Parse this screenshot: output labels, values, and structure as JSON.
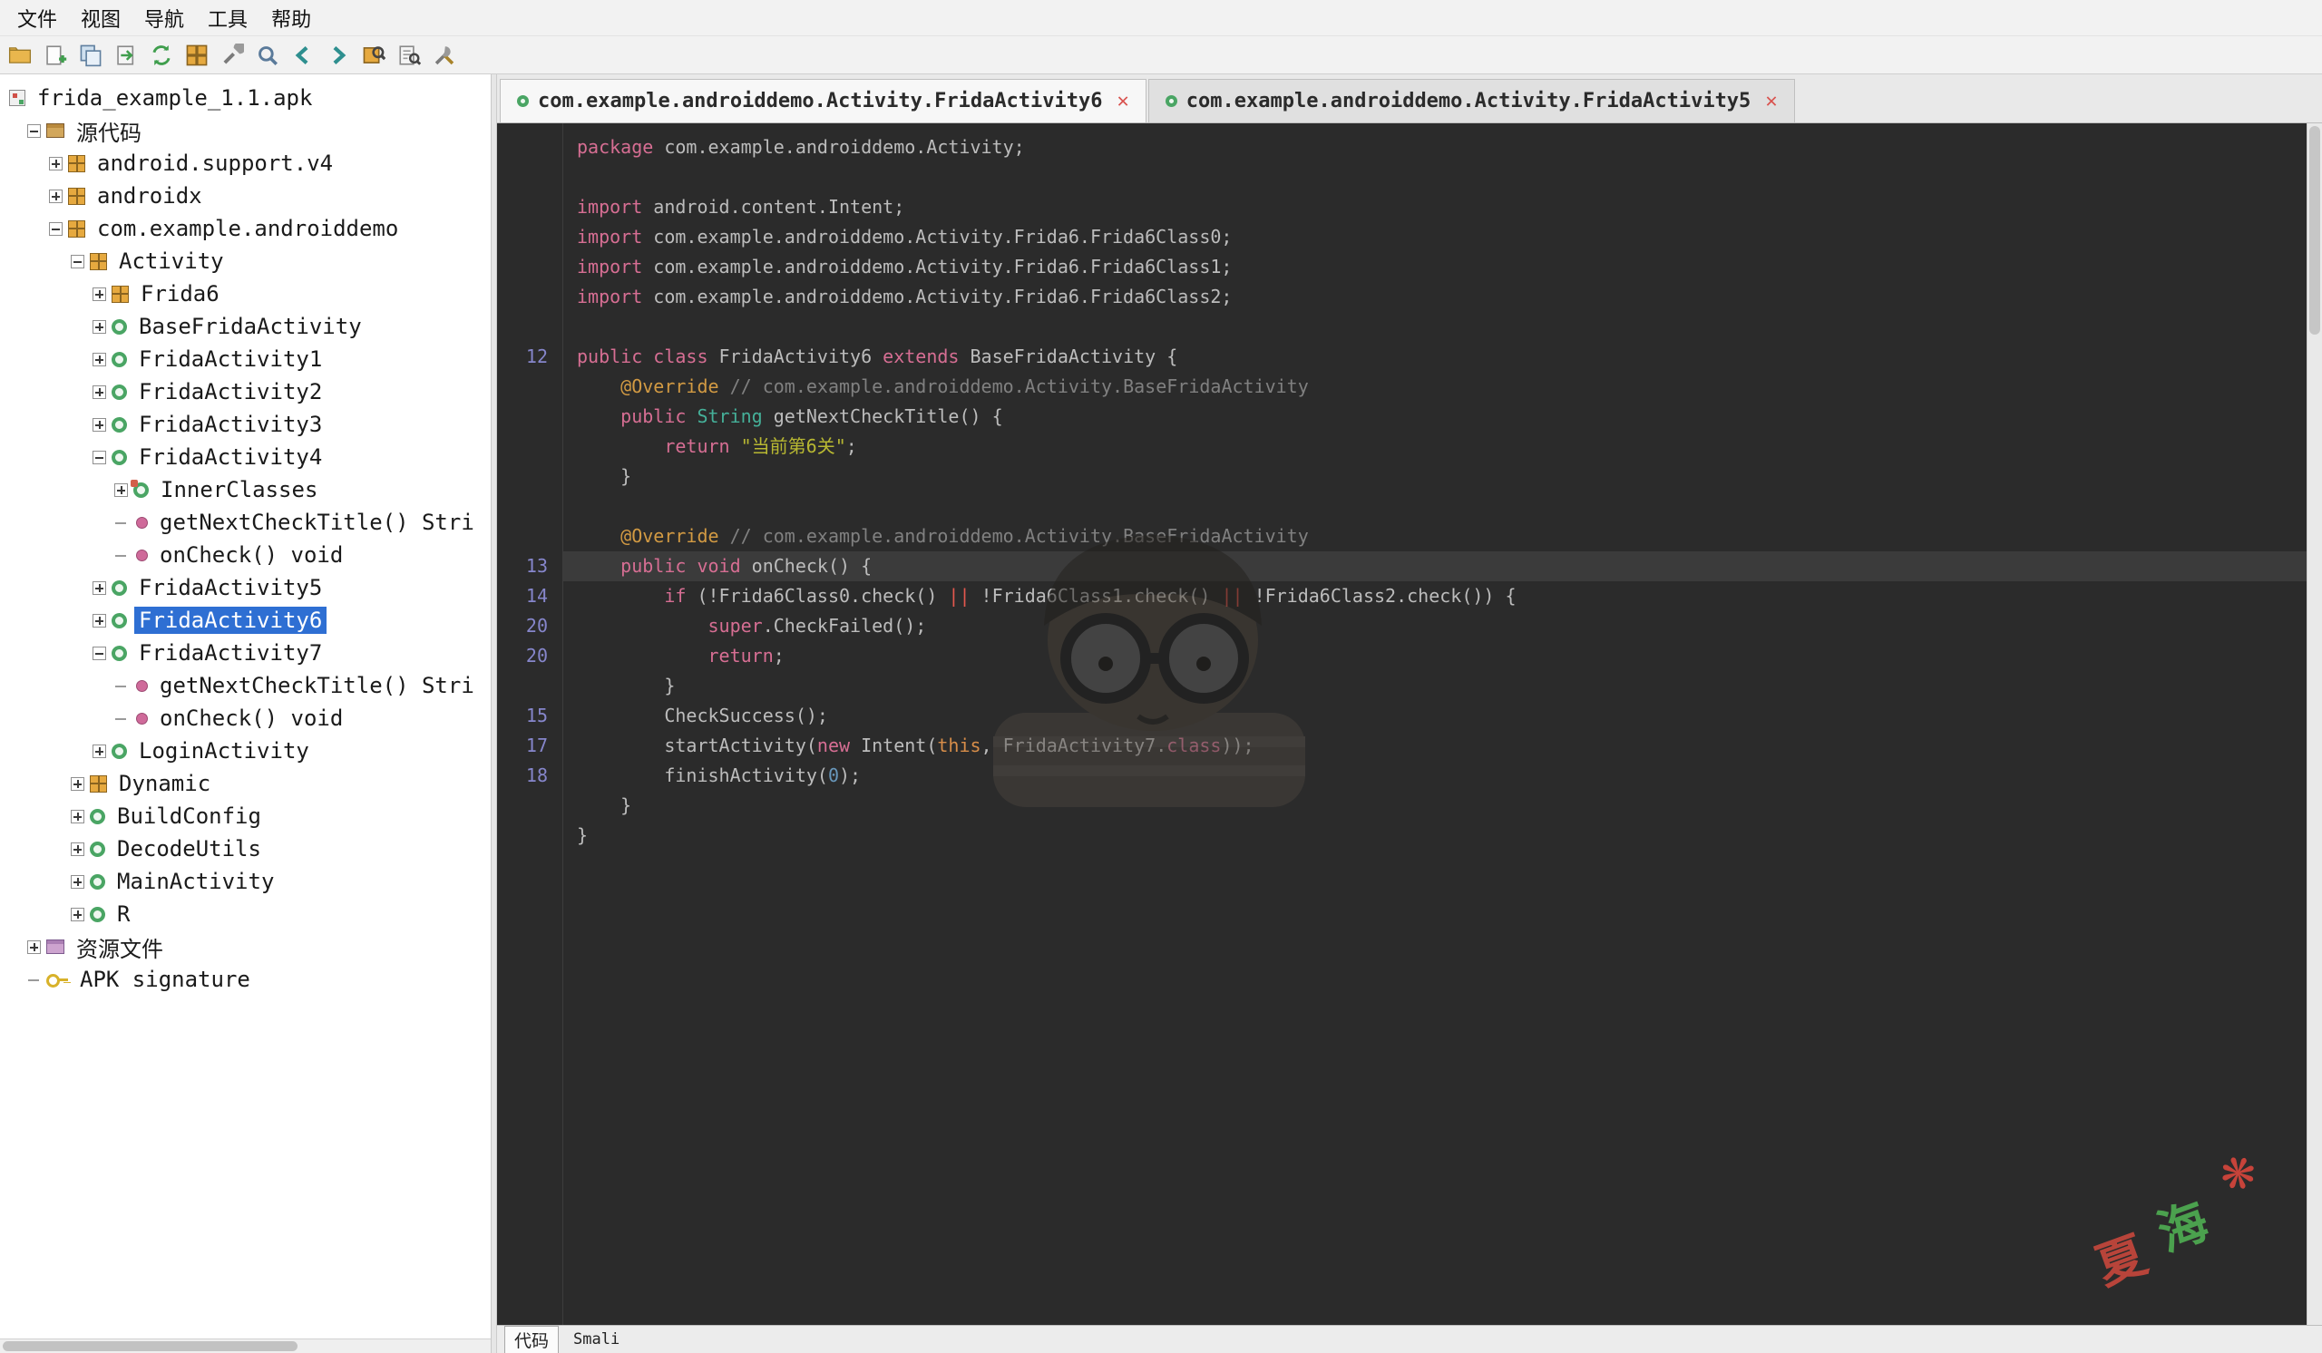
{
  "menu": {
    "items": [
      "文件",
      "视图",
      "导航",
      "工具",
      "帮助"
    ]
  },
  "toolbar": {
    "icons": [
      "open-file",
      "add-files",
      "save-all",
      "export",
      "sync",
      "flat-packages",
      "deobfuscation",
      "search",
      "back",
      "forward",
      "class-search",
      "text-search",
      "preferences"
    ]
  },
  "tree": {
    "items": [
      {
        "label": "frida_example_1.1.apk",
        "level": 0,
        "toggle": "none",
        "icon": "apk",
        "selected": false
      },
      {
        "label": "源代码",
        "level": 1,
        "toggle": "minus",
        "icon": "source",
        "selected": false
      },
      {
        "label": "android.support.v4",
        "level": 2,
        "toggle": "plus",
        "icon": "package",
        "selected": false
      },
      {
        "label": "androidx",
        "level": 2,
        "toggle": "plus",
        "icon": "package",
        "selected": false
      },
      {
        "label": "com.example.androiddemo",
        "level": 2,
        "toggle": "minus",
        "icon": "package",
        "selected": false
      },
      {
        "label": "Activity",
        "level": 3,
        "toggle": "minus",
        "icon": "package",
        "selected": false
      },
      {
        "label": "Frida6",
        "level": 4,
        "toggle": "plus",
        "icon": "package",
        "selected": false
      },
      {
        "label": "BaseFridaActivity",
        "level": 4,
        "toggle": "plus",
        "icon": "class",
        "selected": false
      },
      {
        "label": "FridaActivity1",
        "level": 4,
        "toggle": "plus",
        "icon": "class",
        "selected": false
      },
      {
        "label": "FridaActivity2",
        "level": 4,
        "toggle": "plus",
        "icon": "class",
        "selected": false
      },
      {
        "label": "FridaActivity3",
        "level": 4,
        "toggle": "plus",
        "icon": "class",
        "selected": false
      },
      {
        "label": "FridaActivity4",
        "level": 4,
        "toggle": "minus",
        "icon": "class",
        "selected": false
      },
      {
        "label": "InnerClasses",
        "level": 5,
        "toggle": "plus",
        "icon": "innerclass",
        "selected": false
      },
      {
        "label": "getNextCheckTitle() Stri",
        "level": 5,
        "toggle": "dash",
        "icon": "method",
        "selected": false
      },
      {
        "label": "onCheck() void",
        "level": 5,
        "toggle": "dash",
        "icon": "method",
        "selected": false
      },
      {
        "label": "FridaActivity5",
        "level": 4,
        "toggle": "plus",
        "icon": "class",
        "selected": false
      },
      {
        "label": "FridaActivity6",
        "level": 4,
        "toggle": "plus",
        "icon": "class",
        "selected": true
      },
      {
        "label": "FridaActivity7",
        "level": 4,
        "toggle": "minus",
        "icon": "class",
        "selected": false
      },
      {
        "label": "getNextCheckTitle() Stri",
        "level": 5,
        "toggle": "dash",
        "icon": "method",
        "selected": false
      },
      {
        "label": "onCheck() void",
        "level": 5,
        "toggle": "dash",
        "icon": "method",
        "selected": false
      },
      {
        "label": "LoginActivity",
        "level": 4,
        "toggle": "plus",
        "icon": "class",
        "selected": false
      },
      {
        "label": "Dynamic",
        "level": 3,
        "toggle": "plus",
        "icon": "package",
        "selected": false
      },
      {
        "label": "BuildConfig",
        "level": 3,
        "toggle": "plus",
        "icon": "class",
        "selected": false
      },
      {
        "label": "DecodeUtils",
        "level": 3,
        "toggle": "plus",
        "icon": "class",
        "selected": false
      },
      {
        "label": "MainActivity",
        "level": 3,
        "toggle": "plus",
        "icon": "class",
        "selected": false
      },
      {
        "label": "R",
        "level": 3,
        "toggle": "plus",
        "icon": "class",
        "selected": false
      },
      {
        "label": "资源文件",
        "level": 1,
        "toggle": "plus",
        "icon": "resource",
        "selected": false
      },
      {
        "label": "APK signature",
        "level": 1,
        "toggle": "dash",
        "icon": "key",
        "selected": false
      }
    ]
  },
  "tabs": [
    {
      "label": "com.example.androiddemo.Activity.FridaActivity6",
      "active": true
    },
    {
      "label": "com.example.androiddemo.Activity.FridaActivity5",
      "active": false
    }
  ],
  "editor": {
    "lines": [
      {
        "num": "",
        "hl": false,
        "tokens": [
          {
            "t": "package ",
            "c": "kw"
          },
          {
            "t": "com.example.androiddemo.Activity;",
            "c": "def"
          }
        ]
      },
      {
        "num": "",
        "hl": false,
        "tokens": []
      },
      {
        "num": "",
        "hl": false,
        "tokens": [
          {
            "t": "import ",
            "c": "kw"
          },
          {
            "t": "android.content.Intent;",
            "c": "def"
          }
        ]
      },
      {
        "num": "",
        "hl": false,
        "tokens": [
          {
            "t": "import ",
            "c": "kw"
          },
          {
            "t": "com.example.androiddemo.Activity.Frida6.Frida6Class0;",
            "c": "def"
          }
        ]
      },
      {
        "num": "",
        "hl": false,
        "tokens": [
          {
            "t": "import ",
            "c": "kw"
          },
          {
            "t": "com.example.androiddemo.Activity.Frida6.Frida6Class1;",
            "c": "def"
          }
        ]
      },
      {
        "num": "",
        "hl": false,
        "tokens": [
          {
            "t": "import ",
            "c": "kw"
          },
          {
            "t": "com.example.androiddemo.Activity.Frida6.Frida6Class2;",
            "c": "def"
          }
        ]
      },
      {
        "num": "",
        "hl": false,
        "tokens": []
      },
      {
        "num": "12",
        "hl": false,
        "tokens": [
          {
            "t": "public class ",
            "c": "kw"
          },
          {
            "t": "FridaActivity6 ",
            "c": "def"
          },
          {
            "t": "extends ",
            "c": "kw"
          },
          {
            "t": "BaseFridaActivity {",
            "c": "def"
          }
        ]
      },
      {
        "num": "",
        "hl": false,
        "tokens": [
          {
            "t": "    ",
            "c": "def"
          },
          {
            "t": "@Override ",
            "c": "ann"
          },
          {
            "t": "// com.example.androiddemo.Activity.BaseFridaActivity",
            "c": "com"
          }
        ]
      },
      {
        "num": "",
        "hl": false,
        "tokens": [
          {
            "t": "    ",
            "c": "def"
          },
          {
            "t": "public ",
            "c": "kw"
          },
          {
            "t": "String ",
            "c": "type"
          },
          {
            "t": "getNextCheckTitle() {",
            "c": "def"
          }
        ]
      },
      {
        "num": "",
        "hl": false,
        "tokens": [
          {
            "t": "        ",
            "c": "def"
          },
          {
            "t": "return ",
            "c": "kw"
          },
          {
            "t": "\"当前第6关\"",
            "c": "str"
          },
          {
            "t": ";",
            "c": "def"
          }
        ]
      },
      {
        "num": "",
        "hl": false,
        "tokens": [
          {
            "t": "    }",
            "c": "def"
          }
        ]
      },
      {
        "num": "",
        "hl": false,
        "tokens": []
      },
      {
        "num": "",
        "hl": false,
        "tokens": [
          {
            "t": "    ",
            "c": "def"
          },
          {
            "t": "@Override ",
            "c": "ann"
          },
          {
            "t": "// com.example.androiddemo.Activity.BaseFridaActivity",
            "c": "com"
          }
        ]
      },
      {
        "num": "13",
        "hl": true,
        "tokens": [
          {
            "t": "    ",
            "c": "def"
          },
          {
            "t": "public void ",
            "c": "kw"
          },
          {
            "t": "onCheck() {",
            "c": "def"
          }
        ]
      },
      {
        "num": "14",
        "hl": false,
        "tokens": [
          {
            "t": "        ",
            "c": "def"
          },
          {
            "t": "if ",
            "c": "kw"
          },
          {
            "t": "(!Frida6Class0.check() ",
            "c": "def"
          },
          {
            "t": "|| ",
            "c": "op"
          },
          {
            "t": "!Frida6Class1.check() ",
            "c": "def"
          },
          {
            "t": "|| ",
            "c": "op"
          },
          {
            "t": "!Frida6Class2.check()) {",
            "c": "def"
          }
        ]
      },
      {
        "num": "20",
        "hl": false,
        "tokens": [
          {
            "t": "            ",
            "c": "def"
          },
          {
            "t": "super",
            "c": "kw"
          },
          {
            "t": ".CheckFailed();",
            "c": "def"
          }
        ]
      },
      {
        "num": "20",
        "hl": false,
        "tokens": [
          {
            "t": "            ",
            "c": "def"
          },
          {
            "t": "return",
            "c": "kw"
          },
          {
            "t": ";",
            "c": "def"
          }
        ]
      },
      {
        "num": "",
        "hl": false,
        "tokens": [
          {
            "t": "        }",
            "c": "def"
          }
        ]
      },
      {
        "num": "15",
        "hl": false,
        "tokens": [
          {
            "t": "        CheckSuccess();",
            "c": "def"
          }
        ]
      },
      {
        "num": "17",
        "hl": false,
        "tokens": [
          {
            "t": "        startActivity(",
            "c": "def"
          },
          {
            "t": "new ",
            "c": "kw"
          },
          {
            "t": "Intent(",
            "c": "def"
          },
          {
            "t": "this",
            "c": "this"
          },
          {
            "t": ", FridaActivity7.",
            "c": "def"
          },
          {
            "t": "class",
            "c": "kw"
          },
          {
            "t": "));",
            "c": "def"
          }
        ]
      },
      {
        "num": "18",
        "hl": false,
        "tokens": [
          {
            "t": "        finishActivity(",
            "c": "def"
          },
          {
            "t": "0",
            "c": "num"
          },
          {
            "t": ");",
            "c": "def"
          }
        ]
      },
      {
        "num": "",
        "hl": false,
        "tokens": [
          {
            "t": "    }",
            "c": "def"
          }
        ]
      },
      {
        "num": "",
        "hl": false,
        "tokens": [
          {
            "t": "}",
            "c": "def"
          }
        ]
      }
    ]
  },
  "bottom_tabs": [
    {
      "label": "代码",
      "active": true
    },
    {
      "label": "Smali",
      "active": false
    }
  ],
  "watermark": {
    "signature_chars": [
      {
        "char": "夏",
        "color": "#c8473c"
      },
      {
        "char": "海",
        "color": "#4fae52"
      },
      {
        "char": "❋",
        "color": "#d8463c"
      }
    ]
  },
  "colors": {
    "selection_blue": "#2e6fd3",
    "editor_background": "#2b2b2b",
    "current_line": "#3b3b3b",
    "keyword": "#d66e93",
    "string": "#b8b832",
    "comment": "#808080",
    "annotation": "#d29a43",
    "type": "#45b099",
    "number": "#6897bb",
    "operator": "#e4584e",
    "line_number": "#8686cb",
    "default_text": "#bcbcbc",
    "tab_close_red": "#d9534f",
    "class_icon_green": "#4aa564",
    "package_icon_orange": "#e6a93f"
  }
}
